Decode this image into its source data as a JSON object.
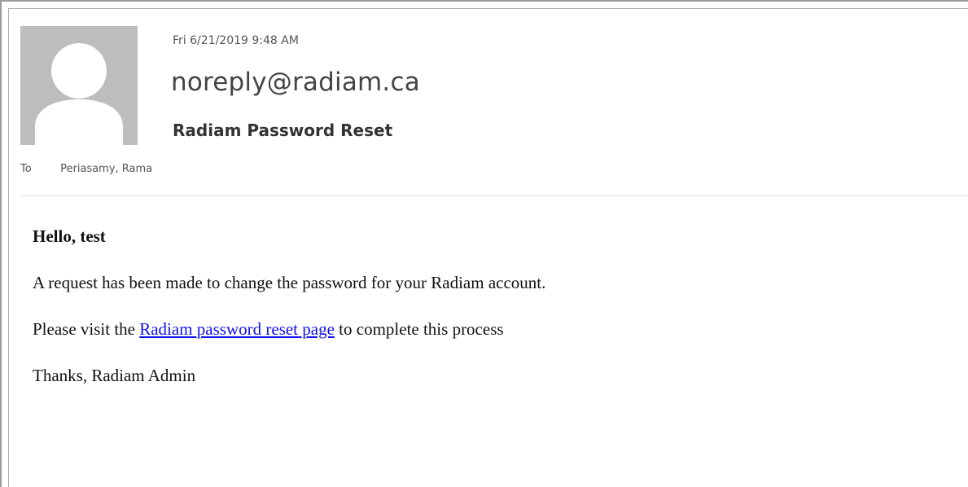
{
  "email": {
    "date": "Fri 6/21/2019 9:48 AM",
    "sender": "noreply@radiam.ca",
    "subject": "Radiam Password Reset",
    "to_label": "To",
    "to_name": "Periasamy, Rama",
    "avatar_icon": "person-icon",
    "body": {
      "greeting": "Hello, test",
      "line1": "A request has been made to change the password for your Radiam account.",
      "line2_before": "Please visit the ",
      "line2_link": "Radiam password reset page",
      "line2_after": " to complete this process",
      "signoff": "Thanks, Radiam Admin"
    }
  },
  "colors": {
    "avatar_bg": "#bdbdbd",
    "avatar_fg": "#ffffff",
    "link": "#1010ee"
  }
}
